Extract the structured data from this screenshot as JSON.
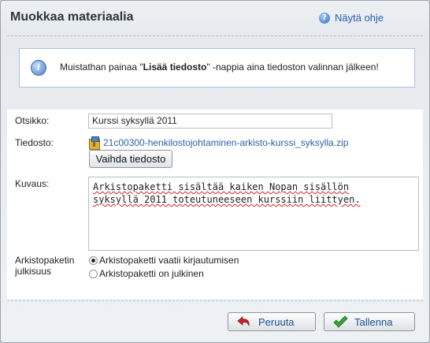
{
  "dialog": {
    "title": "Muokkaa materiaalia",
    "help_label": "Näytä ohje"
  },
  "notice": {
    "text_before": "Muistathan painaa \"",
    "text_bold": "Lisää tiedosto",
    "text_after": "\" -nappia aina tiedoston valinnan jälkeen!"
  },
  "form": {
    "title_label": "Otsikko:",
    "title_value": "Kurssi syksyllä 2011",
    "file_label": "Tiedosto:",
    "file_name": "21c00300-henkilostojohtaminen-arkisto-kurssi_syksylla.zip",
    "change_file_button": "Vaihda tiedosto",
    "description_label": "Kuvaus:",
    "description_line1": "Arkistopaketti sisältää kaiken Nopan sisällön",
    "description_line2": "syksyllä 2011 toteutuneeseen kurssiin liittyen.",
    "publicity_label_line1": "Arkistopaketin",
    "publicity_label_line2": "julkisuus",
    "publicity_options": [
      {
        "label": "Arkistopaketti vaatii kirjautumisen",
        "selected": true
      },
      {
        "label": "Arkistopaketti on julkinen",
        "selected": false
      }
    ]
  },
  "footer": {
    "cancel_button": "Peruuta",
    "save_button": "Tallenna"
  },
  "background_peek_text": "..."
}
